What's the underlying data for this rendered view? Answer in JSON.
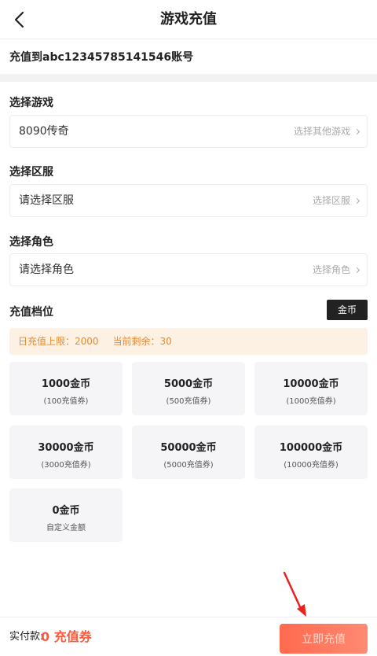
{
  "header": {
    "title": "游戏充值"
  },
  "account": {
    "text": "充值到abc12345785141546账号"
  },
  "game": {
    "label": "选择游戏",
    "value": "8090传奇",
    "hint": "选择其他游戏"
  },
  "server": {
    "label": "选择区服",
    "value": "请选择区服",
    "hint": "选择区服"
  },
  "role": {
    "label": "选择角色",
    "value": "请选择角色",
    "hint": "选择角色"
  },
  "tiers": {
    "label": "充值档位",
    "currency_tag": "金币",
    "daily_limit": "日充值上限：2000",
    "remaining": "当前剩余：30",
    "items": [
      {
        "amount": "1000金币",
        "sub": "(100充值券)"
      },
      {
        "amount": "5000金币",
        "sub": "(500充值券)"
      },
      {
        "amount": "10000金币",
        "sub": "(1000充值券)"
      },
      {
        "amount": "30000金币",
        "sub": "(3000充值券)"
      },
      {
        "amount": "50000金币",
        "sub": "(5000充值券)"
      },
      {
        "amount": "100000金币",
        "sub": "(10000充值券)"
      },
      {
        "amount": "0金币",
        "sub": "自定义金额"
      }
    ]
  },
  "footer": {
    "pay_label": "实付款:",
    "pay_amount": "0 充值券",
    "button": "立即充值"
  },
  "colors": {
    "accent": "#ff5a3c",
    "banner_text": "#e8892f",
    "banner_bg": "#fdf1e4",
    "annotation": "#e8231f"
  }
}
